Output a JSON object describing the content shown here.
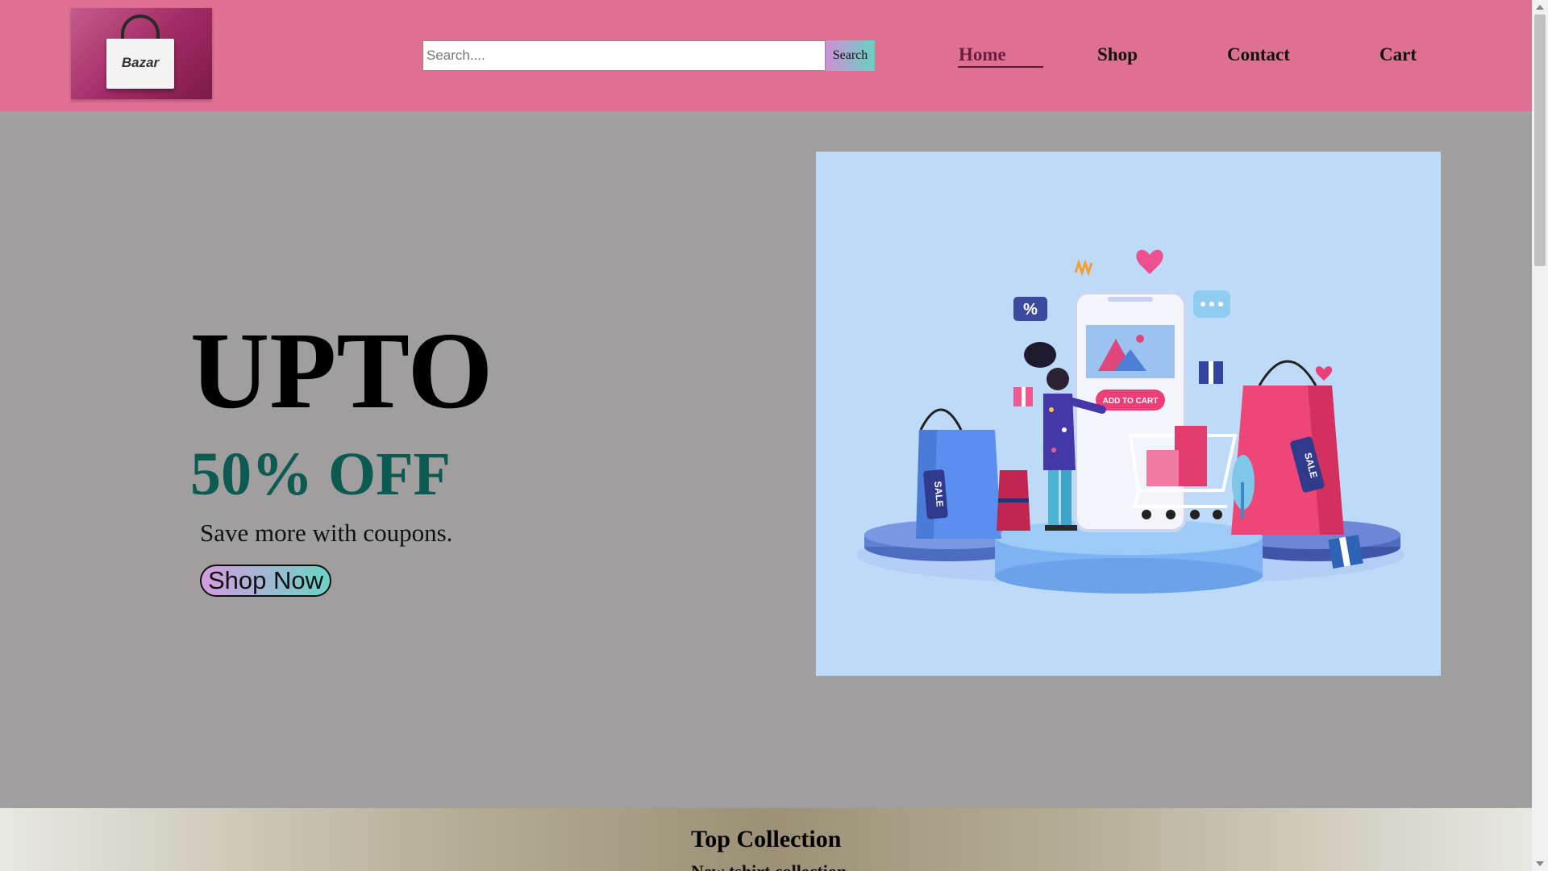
{
  "header": {
    "logo": {
      "brand": "Bazar",
      "icon": "shopping-bag-logo"
    },
    "search": {
      "placeholder": "Search....",
      "value": "",
      "button_label": "Search"
    },
    "nav": [
      {
        "label": "Home",
        "active": true
      },
      {
        "label": "Shop",
        "active": false
      },
      {
        "label": "Contact",
        "active": false
      },
      {
        "label": "Cart",
        "active": false
      }
    ]
  },
  "hero": {
    "headline": "UPTO",
    "discount": "50% OFF",
    "tagline": "Save more with coupons.",
    "cta_label": "Shop Now",
    "illustration": {
      "icon": "online-shopping-illustration",
      "add_to_cart_label": "ADD TO CART",
      "sale_tag": "SALE",
      "percent_badge": "%"
    }
  },
  "collection": {
    "title": "Top Collection",
    "subtitle": "New tshirt collection"
  },
  "colors": {
    "header_bg": "#de7191",
    "page_bg": "#a09e9f",
    "discount_text": "#0c5a50",
    "hero_image_bg": "#bedaf9"
  }
}
